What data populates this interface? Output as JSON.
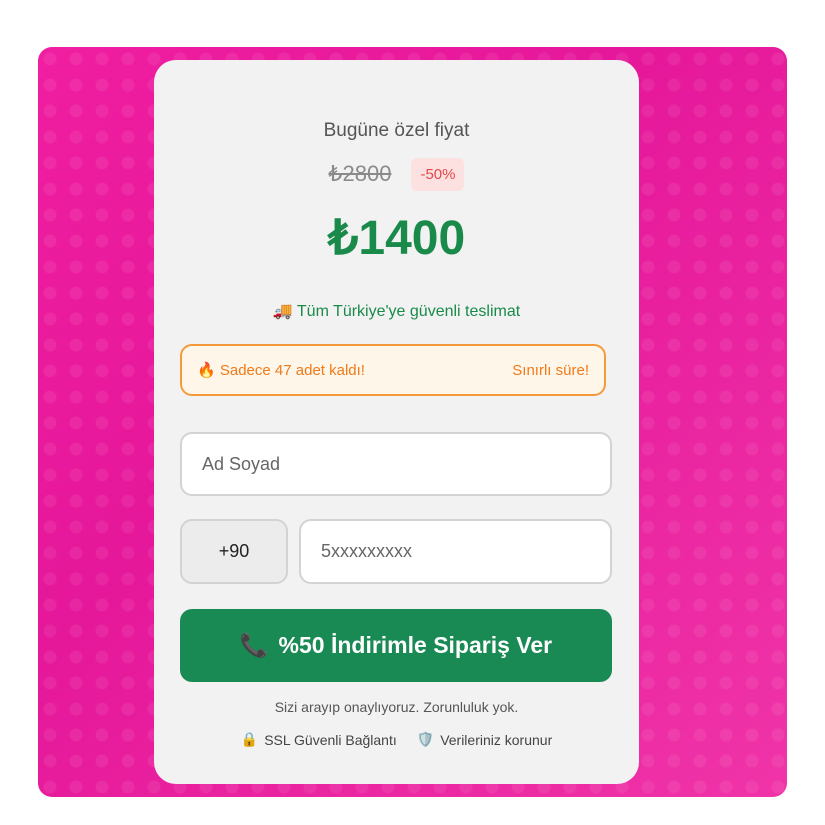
{
  "offer": {
    "headline": "Bugüne özel fiyat",
    "old_price": "₺2800",
    "discount": "-50%",
    "new_price": "₺1400",
    "delivery_icon": "🚚",
    "delivery_text": "Tüm Türkiye'ye güvenli teslimat"
  },
  "stock": {
    "icon": "🔥",
    "text": "Sadece 47 adet kaldı!",
    "timer_text": "Sınırlı süre!"
  },
  "form": {
    "name_placeholder": "Ad Soyad",
    "country_code": "+90",
    "phone_placeholder": "5xxxxxxxxx",
    "submit_icon": "📞",
    "submit_label": "%50 İndirimle Sipariş Ver"
  },
  "footer": {
    "note": "Sizi arayıp onaylıyoruz. Zorunluluk yok.",
    "ssl_icon": "🔒",
    "ssl_text": "SSL Güvenli Bağlantı",
    "shield_icon": "🛡️",
    "privacy_text": "Verileriniz korunur"
  },
  "colors": {
    "background": "#e91e98",
    "price_green": "#1a8a4b",
    "button_green": "#1a8a55",
    "alert_orange": "#f59a3c"
  }
}
